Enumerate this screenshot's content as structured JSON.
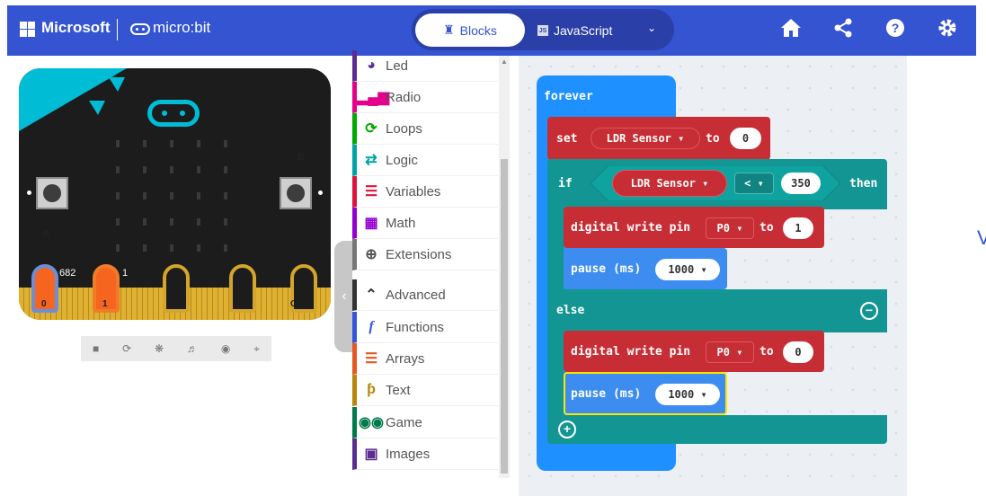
{
  "header": {
    "brand": "Microsoft",
    "product": "micro:bit",
    "tab_blocks": "Blocks",
    "tab_javascript": "JavaScript",
    "js_badge": "JS",
    "colors": {
      "bar": "#3454d1",
      "toggle": "#2b3fa8"
    },
    "icons": [
      "home-icon",
      "share-icon",
      "help-icon",
      "settings-icon"
    ]
  },
  "simulator": {
    "button_a": "A",
    "button_b": "B",
    "pins": [
      "0",
      "1",
      "2",
      "3V",
      "GND"
    ],
    "pin_values": {
      "pin0": "682",
      "pin1": "1"
    },
    "controls": [
      "stop-icon",
      "restart-icon",
      "debug-icon",
      "sound-icon",
      "screenshot-icon",
      "fullscreen-icon"
    ]
  },
  "toolbox": {
    "items": [
      {
        "label": "Led",
        "color": "#5c2d91",
        "icon": "toggle-icon"
      },
      {
        "label": "Radio",
        "color": "#e3008c",
        "icon": "signal-icon"
      },
      {
        "label": "Loops",
        "color": "#00aa00",
        "icon": "loop-icon"
      },
      {
        "label": "Logic",
        "color": "#00a4a6",
        "icon": "shuffle-icon"
      },
      {
        "label": "Variables",
        "color": "#dc143c",
        "icon": "list-icon"
      },
      {
        "label": "Math",
        "color": "#9400d3",
        "icon": "calculator-icon"
      },
      {
        "label": "Extensions",
        "color": "#777777",
        "icon": "plus-circle-icon"
      },
      {
        "label": "Advanced",
        "color": "#333333",
        "icon": "chevron-up-icon"
      },
      {
        "label": "Functions",
        "color": "#3455db",
        "icon": "function-icon"
      },
      {
        "label": "Arrays",
        "color": "#e65722",
        "icon": "list-icon"
      },
      {
        "label": "Text",
        "color": "#b8860b",
        "icon": "text-icon"
      },
      {
        "label": "Game",
        "color": "#007a4b",
        "icon": "gamepad-icon"
      },
      {
        "label": "Images",
        "color": "#5c2d91",
        "icon": "image-icon"
      }
    ]
  },
  "code": {
    "forever": "forever",
    "set_kw": "set",
    "variable": "LDR Sensor",
    "to_kw": "to",
    "set_value": "0",
    "if_kw": "if",
    "operator": "<",
    "compare_value": "350",
    "then_kw": "then",
    "dw1": {
      "label": "digital write pin",
      "pin": "P0",
      "to": "to",
      "value": "1"
    },
    "pause1": {
      "label": "pause (ms)",
      "value": "1000"
    },
    "else_kw": "else",
    "dw2": {
      "label": "digital write pin",
      "pin": "P0",
      "to": "to",
      "value": "0"
    },
    "pause2": {
      "label": "pause (ms)",
      "value": "1000"
    },
    "dropdown_arrow": "▾",
    "minus": "−",
    "plus": "+"
  },
  "side_char": "V"
}
